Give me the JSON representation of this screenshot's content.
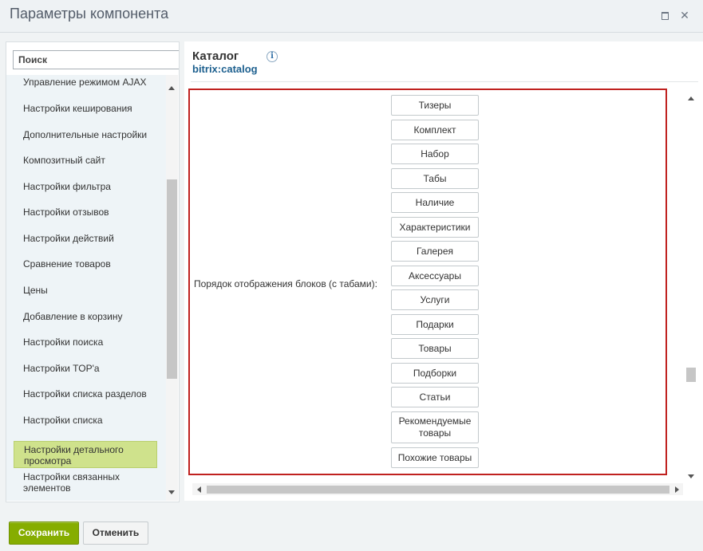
{
  "window": {
    "title": "Параметры компонента"
  },
  "sidebar": {
    "search_placeholder": "Поиск",
    "items": [
      {
        "label": "Управление режимом AJAX"
      },
      {
        "label": "Настройки кеширования"
      },
      {
        "label": "Дополнительные настройки"
      },
      {
        "label": "Композитный сайт"
      },
      {
        "label": "Настройки фильтра"
      },
      {
        "label": "Настройки отзывов"
      },
      {
        "label": "Настройки действий"
      },
      {
        "label": "Сравнение товаров"
      },
      {
        "label": "Цены"
      },
      {
        "label": "Добавление в корзину"
      },
      {
        "label": "Настройки поиска"
      },
      {
        "label": "Настройки TOP'а"
      },
      {
        "label": "Настройки списка разделов"
      },
      {
        "label": "Настройки списка"
      },
      {
        "label": "Настройки детального просмотра"
      },
      {
        "label": "Настройки связанных элементов"
      }
    ],
    "active_item": "Настройки детального просмотра"
  },
  "component": {
    "name": "Каталог",
    "code": "bitrix:catalog",
    "info_icon": "i"
  },
  "parameter": {
    "label": "Порядок отображения блоков (с табами):",
    "blocks": [
      "Тизеры",
      "Комплект",
      "Набор",
      "Табы",
      "Наличие",
      "Характеристики",
      "Галерея",
      "Аксессуары",
      "Услуги",
      "Подарки",
      "Товары",
      "Подборки",
      "Статьи",
      "Рекомендуемые товары",
      "Похожие товары"
    ]
  },
  "footer": {
    "save_label": "Сохранить",
    "cancel_label": "Отменить"
  },
  "colors": {
    "save_button": "#86ad00",
    "highlight_border": "#c0211f",
    "active_item": "#cfe28c",
    "component_code": "#1c5f8e"
  }
}
